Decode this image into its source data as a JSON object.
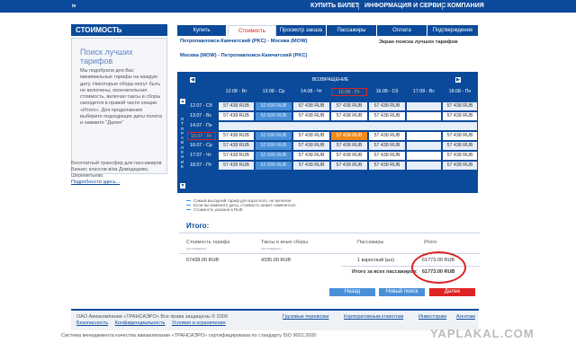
{
  "topbar": {
    "logo": "te",
    "links": [
      "КУПИТЬ БИЛЕТ",
      "ИНФОРМАЦИЯ И СЕРВИС",
      "КОМПАНИЯ"
    ]
  },
  "sidebar": {
    "header": "СТОИМОСТЬ",
    "title": "Поиск лучших тарифов",
    "text": "Мы подобрали для Вас минимальные тарифы на каждую дату. Некоторые сборы могут быть не включены, окончательная стоимость, включая таксы и сборы находится в правой части секции «Итого». Для продолжения выберите подходящие даты полета и нажмите \"Далее\"",
    "promo": "Бесплатный трансфер для пассажиров Бизнес классов в/из Домодедово, Шереметьево.",
    "promo_link": "Подробности здесь..."
  },
  "tabs": [
    "Купить",
    "Стоимость",
    "Просмотр заказа",
    "Пассажиры",
    "Оплата",
    "Подтверждение"
  ],
  "routes": {
    "outbound": "Петропавловск-Камчатский (PKC) - Москва (MOW)",
    "return": "Москва (MOW) - Петропавловск-Камчатский (PKC)",
    "screen_title": "Экран поиска лучших тарифов"
  },
  "grid": {
    "return_label": "ВОЗВРАЩЕНИЕ",
    "departure_label": "ОТПРАВЛЕНИЕ",
    "columns": [
      "12.08 - Вт",
      "13.08 - Ср",
      "14.08 - Чт",
      "15.08 - Пт",
      "16.08 - Сб",
      "17.08 - Вс",
      "18.08 - Пн"
    ],
    "rows": [
      {
        "label": "12.07 - Сб",
        "cells": [
          "57 438 RUB",
          "52 690 RUB",
          "57 438 RUB",
          "57 438 RUB",
          "57 438 RUB",
          "",
          "57 438 RUB"
        ]
      },
      {
        "label": "13.07 - Вс",
        "cells": [
          "57 438 RUB",
          "52 690 RUB",
          "57 438 RUB",
          "57 438 RUB",
          "57 438 RUB",
          "",
          "57 438 RUB"
        ]
      },
      {
        "label": "14.07 - Пн",
        "cells": [
          "",
          "",
          "",
          "",
          "",
          "",
          ""
        ]
      },
      {
        "label": "15.07 - Вт",
        "cells": [
          "57 438 RUB",
          "52 690 RUB",
          "57 438 RUB",
          "57 438 RUB",
          "57 438 RUB",
          "",
          "57 438 RUB"
        ]
      },
      {
        "label": "16.07 - Ср",
        "cells": [
          "57 438 RUB",
          "52 690 RUB",
          "57 438 RUB",
          "57 438 RUB",
          "57 438 RUB",
          "",
          "57 438 RUB"
        ]
      },
      {
        "label": "17.07 - Чт",
        "cells": [
          "57 438 RUB",
          "52 690 RUB",
          "57 438 RUB",
          "57 438 RUB",
          "57 438 RUB",
          "",
          "57 438 RUB"
        ]
      },
      {
        "label": "18.07 - Пт",
        "cells": [
          "57 438 RUB",
          "52 690 RUB",
          "57 438 RUB",
          "57 438 RUB",
          "57 438 RUB",
          "",
          "57 438 RUB"
        ]
      }
    ]
  },
  "legend": [
    "Самый выгодный тариф для взрослого, не включая",
    "Если вы измените даты, стоимость может измениться",
    "Стоимость указана в RUB"
  ],
  "itogo": {
    "title": "Итого:",
    "headers": [
      "Стоимость тарифа",
      "Таксы и иные сборы",
      "Пассажиры",
      "Итого"
    ],
    "subs": [
      "(за каждого)",
      "(за каждого)"
    ],
    "fare": "57438.00 RUB",
    "taxes": "4335.00 RUB",
    "passengers": "1 взрослый (ых)",
    "total_row": "61773.00 RUB",
    "total_all_label": "Итого за всех пассажиров:",
    "total_all": "61773.00 RUB"
  },
  "buttons": {
    "back": "Назад",
    "new_search": "Новый поиск",
    "next": "Далее"
  },
  "footer": {
    "copyright": "ОАО Авиакомпания «ТРАНСАЭРО» Все права защищены © 2009",
    "links": [
      "Безопасность",
      "Конфиденциальность",
      "Условия и ограничения"
    ],
    "right_links": [
      "Грузовые перевозки",
      "Корпоративным клиентам",
      "Инвесторам",
      "Агентам"
    ]
  },
  "iso": "Система менеджмента качества авиакомпании «ТРАНСАЭРО» сертифицирована по стандарту ISO 9001:2000",
  "watermark": "YAPLAKAL.COM",
  "colors": {
    "brand": "#0b4a9b",
    "accent": "#d22222",
    "highlight": "#f28a1a",
    "cheap": "#4a90d9"
  }
}
